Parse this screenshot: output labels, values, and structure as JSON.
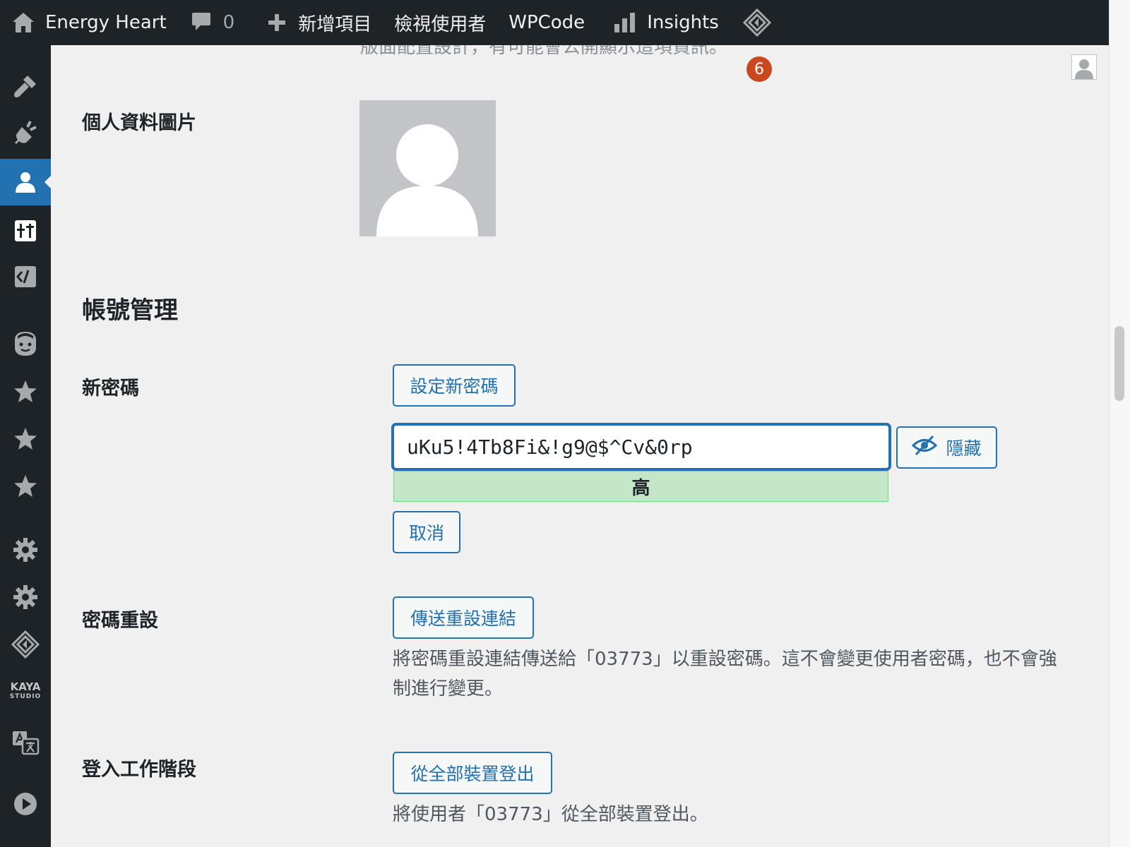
{
  "adminbar": {
    "site_name": "Energy Heart",
    "comments_count": "0",
    "new_item": "新增項目",
    "view_user": "檢視使用者",
    "wpcode": "WPCode",
    "insights": "Insights"
  },
  "notification_count": "6",
  "cut_off_text": "版面配置設計，有可能會公開顯示這項資訊。",
  "profile_picture": {
    "label": "個人資料圖片"
  },
  "account_management": {
    "heading": "帳號管理",
    "new_password": {
      "label": "新密碼",
      "set_button": "設定新密碼",
      "value": "uKu5!4Tb8Fi&!g9@$^Cv&0rp",
      "hide_button": "隱藏",
      "strength": "高",
      "cancel_button": "取消"
    },
    "password_reset": {
      "label": "密碼重設",
      "send_button": "傳送重設連結",
      "description": "將密碼重設連結傳送給「03773」以重設密碼。這不會變更使用者密碼，也不會強制進行變更。"
    },
    "sessions": {
      "label": "登入工作階段",
      "logout_button": "從全部裝置登出",
      "description": "將使用者「03773」從全部裝置登出。"
    }
  },
  "sidebar": {
    "kaya_line1": "KAYA",
    "kaya_line2": "STUDIO"
  },
  "colors": {
    "adminbar_bg": "#1d2327",
    "accent": "#2271b1",
    "strength_strong_bg": "#c5e6c7",
    "notification_badge": "#c9481d"
  }
}
